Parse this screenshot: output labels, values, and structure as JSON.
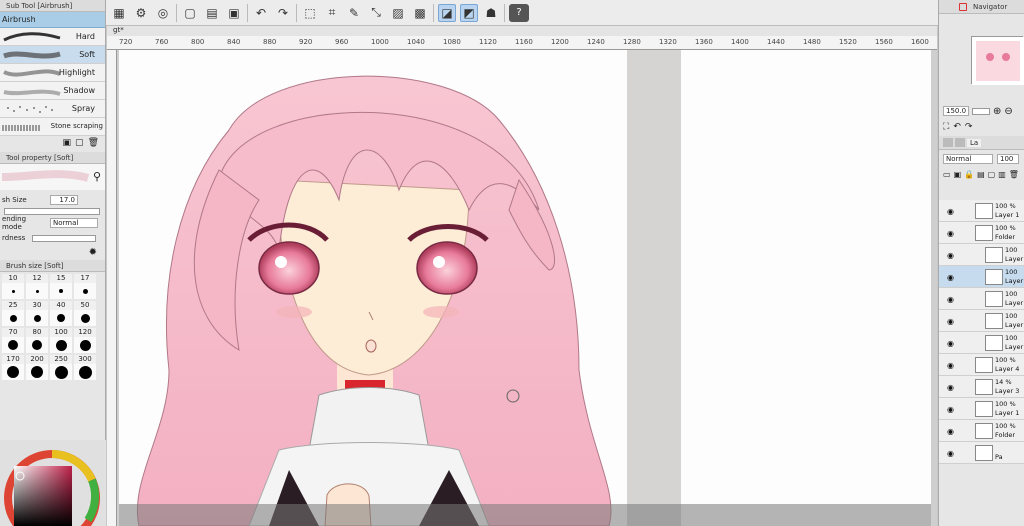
{
  "toolbar": {
    "icons": [
      "grid-icon",
      "settings-icon",
      "spiral-icon",
      "new-icon",
      "open-icon",
      "save-icon",
      "undo-icon",
      "redo-icon",
      "select-icon",
      "crop-icon",
      "pen-icon",
      "transform-icon",
      "clear-icon",
      "fill-icon",
      "lasso-icon",
      "ruler-icon",
      "figure-icon",
      "help-icon"
    ],
    "help_label": "?"
  },
  "sub_tool": {
    "title": "Sub Tool [Airbrush]",
    "selected_tab": "Airbrush",
    "brushes": [
      {
        "label": "Hard"
      },
      {
        "label": "Soft"
      },
      {
        "label": "Highlight"
      },
      {
        "label": "Shadow"
      },
      {
        "label": "Spray"
      },
      {
        "label": "Stone scraping"
      }
    ]
  },
  "tool_property": {
    "title": "Tool property [Soft]",
    "brush_size_label": "sh Size",
    "brush_size_value": "17.0",
    "blending_label": "ending mode",
    "blending_value": "Normal",
    "hardness_label": "rdness"
  },
  "brush_size": {
    "title": "Brush size [Soft]",
    "sizes": [
      "10",
      "12",
      "15",
      "17",
      "25",
      "30",
      "40",
      "50",
      "70",
      "80",
      "100",
      "120",
      "170",
      "200",
      "250",
      "300"
    ],
    "selected": "17"
  },
  "canvas": {
    "tab": "gt*",
    "ruler_ticks": [
      "720",
      "760",
      "800",
      "840",
      "880",
      "920",
      "960",
      "1000",
      "1040",
      "1080",
      "1120",
      "1160",
      "1200",
      "1240",
      "1280",
      "1320",
      "1360",
      "1400",
      "1440",
      "1480",
      "1520",
      "1560",
      "1600"
    ]
  },
  "navigator": {
    "title": "Navigator",
    "zoom": "150.0"
  },
  "layers": {
    "tab": "La",
    "blend_mode": "Normal",
    "opacity": "100",
    "items": [
      {
        "pct": "100 %",
        "name": "Layer 1"
      },
      {
        "pct": "100 %",
        "name": "Folder"
      },
      {
        "pct": "100",
        "name": "Layer"
      },
      {
        "pct": "100",
        "name": "Layer"
      },
      {
        "pct": "100",
        "name": "Layer"
      },
      {
        "pct": "100",
        "name": "Layer"
      },
      {
        "pct": "100",
        "name": "Layer"
      },
      {
        "pct": "100 %",
        "name": "Layer 4"
      },
      {
        "pct": "14 %",
        "name": "Layer 3"
      },
      {
        "pct": "100 %",
        "name": "Layer 1"
      },
      {
        "pct": "100 %",
        "name": "Folder"
      },
      {
        "pct": "",
        "name": "Pa"
      }
    ]
  },
  "colors": {
    "accent": "#a9cde6",
    "hair": "#f6bcc8",
    "skin": "#fdecd6"
  }
}
